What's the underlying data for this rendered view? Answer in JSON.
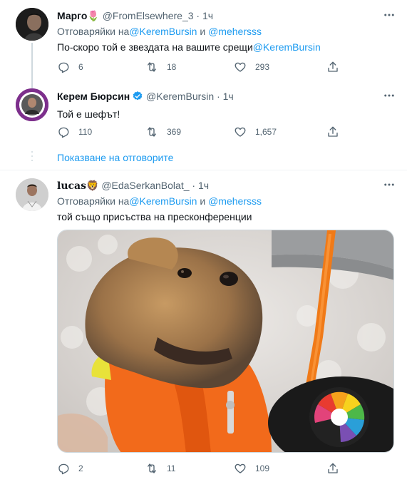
{
  "tweets": [
    {
      "name": "Марго",
      "name_emoji": "🌷",
      "handle": "@FromElsewhere_3",
      "dot": "·",
      "time": "1ч",
      "reply_prefix": "Отговаряйки на",
      "reply_mention_1": "@KeremBursin",
      "reply_and": " и ",
      "reply_mention_2": "@mehersss",
      "text_plain": "По-скоро той е звездата на вашите срещи",
      "text_mention": "@KeremBursin",
      "replies": "6",
      "retweets": "18",
      "likes": "293"
    },
    {
      "name": "Керем Бюрсин",
      "handle": "@KeremBursin",
      "dot": "·",
      "time": "1ч",
      "text": "Той е шефът!",
      "replies": "110",
      "retweets": "369",
      "likes": "1,657"
    },
    {
      "name": "lucas",
      "name_emoji": "🦁",
      "handle": "@EdaSerkanBolat_",
      "dot": "·",
      "time": "1ч",
      "reply_prefix": "Отговаряйки на",
      "reply_mention_1": "@KeremBursin",
      "reply_and": " и ",
      "reply_mention_2": "@mehersss",
      "text": "той също присъства на пресконференции",
      "replies": "2",
      "retweets": "11",
      "likes": "109"
    }
  ],
  "show_replies": "Показване на отговорите",
  "colors": {
    "accent": "#1d9bf0",
    "secondary_text": "#536471",
    "divider": "#eff3f4",
    "thread_line": "#cfd9de"
  },
  "icons": {
    "reply": "reply-icon",
    "retweet": "retweet-icon",
    "like": "heart-icon",
    "share": "share-icon",
    "more": "more-icon",
    "verified": "verified-badge-icon"
  }
}
